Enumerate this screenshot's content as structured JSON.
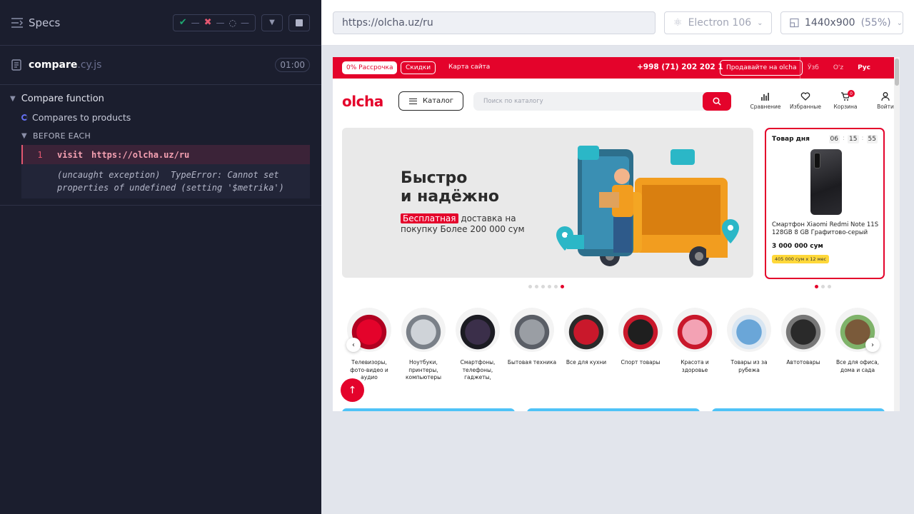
{
  "reporter": {
    "specs_label": "Specs",
    "stats": {
      "passed": "—",
      "failed": "—",
      "pending": "—"
    },
    "spec_file": {
      "name": "compare",
      "ext": ".cy.js",
      "duration": "01:00"
    },
    "suite_title": "Compare function",
    "test_title": "Compares to products",
    "hook_title": "BEFORE EACH",
    "command": {
      "number": "1",
      "name": "visit",
      "message": "https://olcha.uz/ru"
    },
    "error_line1": "(uncaught exception)  TypeError: Cannot set",
    "error_line2": "properties of undefined (setting '$metrika')"
  },
  "aut": {
    "url": "https://olcha.uz/ru",
    "browser": "Electron 106",
    "viewport": "1440x900",
    "scale": "(55%)"
  },
  "site": {
    "topbar": {
      "installment": "0% Рассрочка",
      "discounts": "Скидки",
      "sitemap": "Карта сайта",
      "phone": "+998 (71) 202 202 1",
      "sell": "Продавайте на olcha",
      "langs": [
        "Ўзб",
        "O'z",
        "Рус"
      ]
    },
    "logo": "olcha",
    "catalog": "Каталог",
    "search_placeholder": "Поиск по каталогу",
    "header_icons": [
      {
        "label": "Сравнение",
        "icon": "bar-chart-icon"
      },
      {
        "label": "Избранные",
        "icon": "heart-icon"
      },
      {
        "label": "Корзина",
        "icon": "cart-icon",
        "badge": "0"
      },
      {
        "label": "Войти",
        "icon": "user-icon"
      }
    ],
    "banner": {
      "title_line1": "Быстро",
      "title_line2": "и надёжно",
      "free": "Бесплатная",
      "sub_line1": " доставка на",
      "sub_line2": "покупку Более 200 000 сум",
      "active_slide": 6,
      "slides": 6
    },
    "product_of_day": {
      "title": "Товар дня",
      "timer": [
        "06",
        "15",
        "55"
      ],
      "name": "Смартфон Xiaomi Redmi Note 11S 128GB 8 GB Графитово-серый",
      "price": "3 000 000 сум",
      "credit": "405 000 сум x 12 мес"
    },
    "categories": [
      "Телевизоры, фото-видео и аудио",
      "Ноутбуки, принтеры, компьютеры",
      "Смартфоны, телефоны, гаджеты,",
      "Бытовая техника",
      "Все для кухни",
      "Спорт товары",
      "Красота и здоровье",
      "Товары из за рубежа",
      "Автотовары",
      "Все для офиса, дома и сада"
    ]
  },
  "colors": {
    "brand": "#e4032b",
    "reporter_bg": "#1b1e2e",
    "error": "#e45770"
  }
}
